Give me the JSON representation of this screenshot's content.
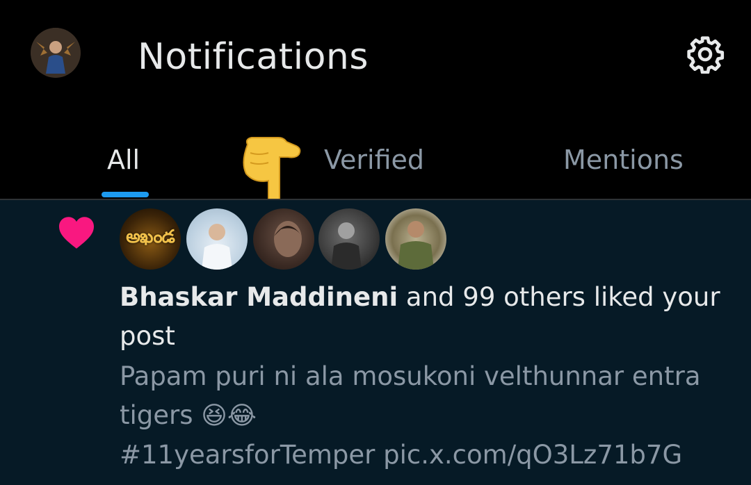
{
  "header": {
    "title": "Notifications",
    "settings_icon": "gear-icon"
  },
  "tabs": [
    {
      "label": "All",
      "active": true
    },
    {
      "label": "Verified",
      "active": false
    },
    {
      "label": "Mentions",
      "active": false
    }
  ],
  "notification": {
    "type": "like",
    "icon": "heart-icon",
    "heart_color": "#f91880",
    "avatars": [
      {
        "label": "అఖండ"
      },
      {
        "label": ""
      },
      {
        "label": ""
      },
      {
        "label": ""
      },
      {
        "label": ""
      }
    ],
    "actor": "Bhaskar Maddineni",
    "action_text": " and 99 others liked your post",
    "post_text": "Papam puri ni ala mosukoni velthunnar entra tigers ",
    "post_emojis": "😆😂",
    "post_hashtag": "#11yearsforTemper",
    "post_link": "pic.x.com/qO3Lz71b7G"
  },
  "colors": {
    "accent": "#1d9bf0",
    "background": "#000000",
    "card_background": "#061a26",
    "text_primary": "#e7e9ea",
    "text_secondary": "#8b98a5"
  }
}
